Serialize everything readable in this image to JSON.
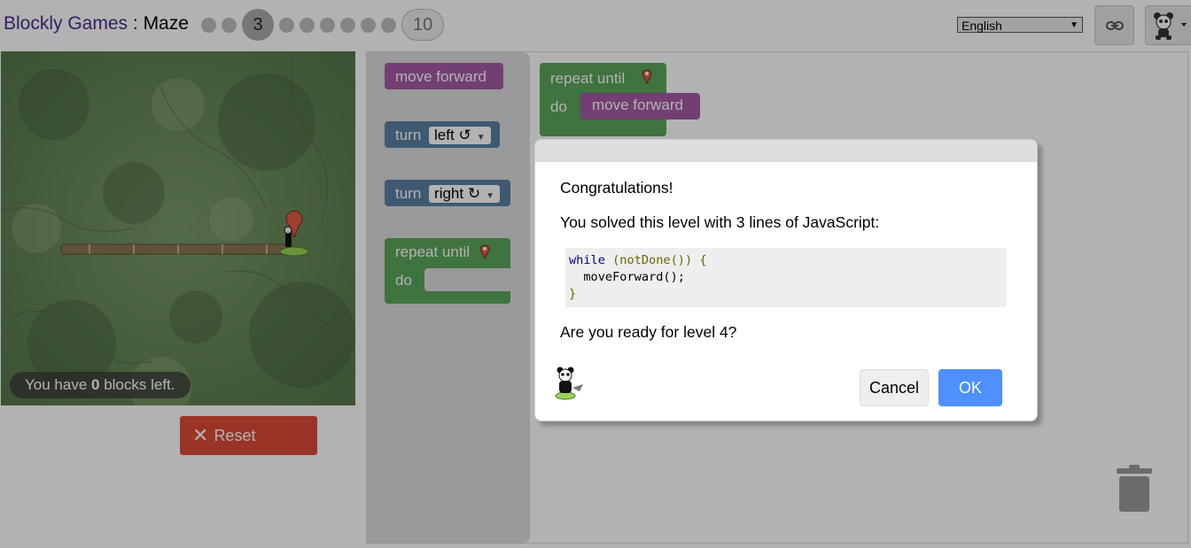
{
  "header": {
    "app_name": "Blockly Games",
    "separator": " : ",
    "game_name": "Maze",
    "current_level": "3",
    "last_level": "10",
    "language": "English",
    "link_icon": "link-icon",
    "avatar_icon": "panda-icon"
  },
  "maze": {
    "capacity_prefix": "You have ",
    "capacity_count": "0",
    "capacity_suffix": " blocks left.",
    "reset_label": "Reset",
    "reset_color": "#dd4b39"
  },
  "toolbox": {
    "move_forward": "move forward",
    "turn": "turn",
    "turn_left": "left ↺",
    "turn_right": "right ↻",
    "repeat_until": "repeat until",
    "do": "do"
  },
  "workspace": {
    "repeat_until": "repeat until",
    "do": "do",
    "move_forward": "move forward",
    "trash_icon": "trash-icon"
  },
  "dialog": {
    "line1": "Congratulations!",
    "line2": "You solved this level with 3 lines of JavaScript:",
    "code": {
      "l1_kw": "while",
      "l1_rest": " (notDone()) {",
      "l2": "  moveForward();",
      "l3": "}"
    },
    "question": "Are you ready for level 4?",
    "cancel_label": "Cancel",
    "ok_label": "OK",
    "ok_color": "#4d90fe"
  },
  "colors": {
    "movement_block": "#a55ba5",
    "turn_block": "#5b80a5",
    "loop_block": "#5ba55b",
    "title_purple": "#4c2b8a"
  }
}
